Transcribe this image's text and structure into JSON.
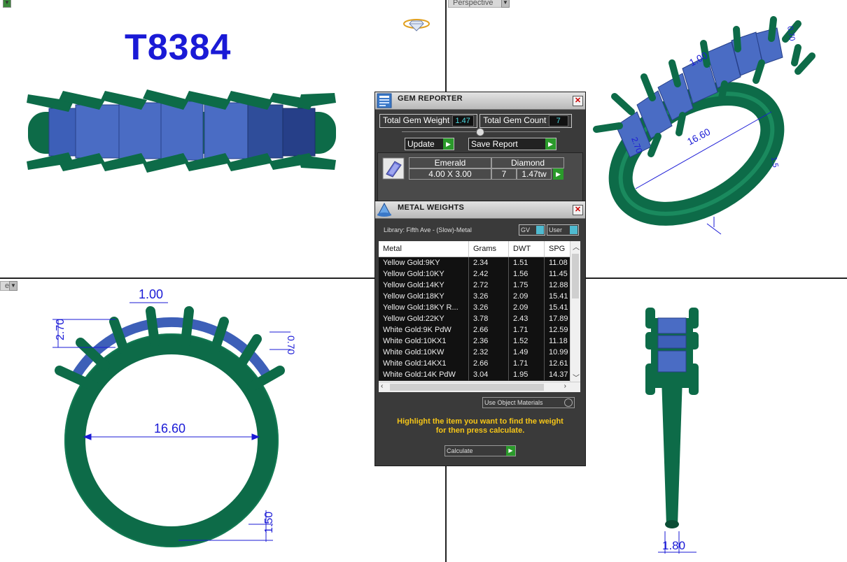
{
  "viewports": {
    "top_right_label": "Perspective",
    "bottom_left_label": "er"
  },
  "model": {
    "title": "T8384",
    "dims": {
      "stone_length": "1.00",
      "stone_width": "2.70",
      "stone_depth": "0.70",
      "ring_size": "16.60",
      "shank_thickness": "1.50",
      "shank_width": "1.80",
      "small_dim": "1.5"
    }
  },
  "gem_reporter": {
    "title": "GEM REPORTER",
    "total_weight_label": "Total Gem Weight",
    "total_weight": "1.47",
    "total_count_label": "Total Gem Count",
    "total_count": "7",
    "update_label": "Update",
    "save_report_label": "Save Report",
    "gem": {
      "shape": "Emerald",
      "size": "4.00 X 3.00",
      "type": "Diamond",
      "count": "7",
      "weight": "1.47tw"
    }
  },
  "metal_weights": {
    "title": "METAL WEIGHTS",
    "library_label": "Library: Fifth Ave - (Slow)-Metal",
    "gv_label": "GV",
    "user_label": "User",
    "columns": [
      "Metal",
      "Grams",
      "DWT",
      "SPG"
    ],
    "rows": [
      [
        "Yellow Gold:9KY",
        "2.34",
        "1.51",
        "11.08"
      ],
      [
        "Yellow Gold:10KY",
        "2.42",
        "1.56",
        "11.45"
      ],
      [
        "Yellow Gold:14KY",
        "2.72",
        "1.75",
        "12.88"
      ],
      [
        "Yellow Gold:18KY",
        "3.26",
        "2.09",
        "15.41"
      ],
      [
        "Yellow Gold:18KY R...",
        "3.26",
        "2.09",
        "15.41"
      ],
      [
        "Yellow Gold:22KY",
        "3.78",
        "2.43",
        "17.89"
      ],
      [
        "White Gold:9K PdW",
        "2.66",
        "1.71",
        "12.59"
      ],
      [
        "White Gold:10KX1",
        "2.36",
        "1.52",
        "11.18"
      ],
      [
        "White Gold:10KW",
        "2.32",
        "1.49",
        "10.99"
      ],
      [
        "White Gold:14KX1",
        "2.66",
        "1.71",
        "12.61"
      ],
      [
        "White Gold:14K PdW",
        "3.04",
        "1.95",
        "14.37"
      ]
    ],
    "use_object_materials_label": "Use Object Materials",
    "hint_line1": "Highlight the item you want to find the weight",
    "hint_line2": "for then press calculate.",
    "calculate_label": "Calculate"
  },
  "colors": {
    "ring_green": "#0d6b48",
    "ring_green_light": "#1a8a5e",
    "stone_blue": "#3d5fb8",
    "stone_blue_dark": "#263f88",
    "dim_blue": "#1a1ad6",
    "hint_yellow": "#f5c518"
  }
}
